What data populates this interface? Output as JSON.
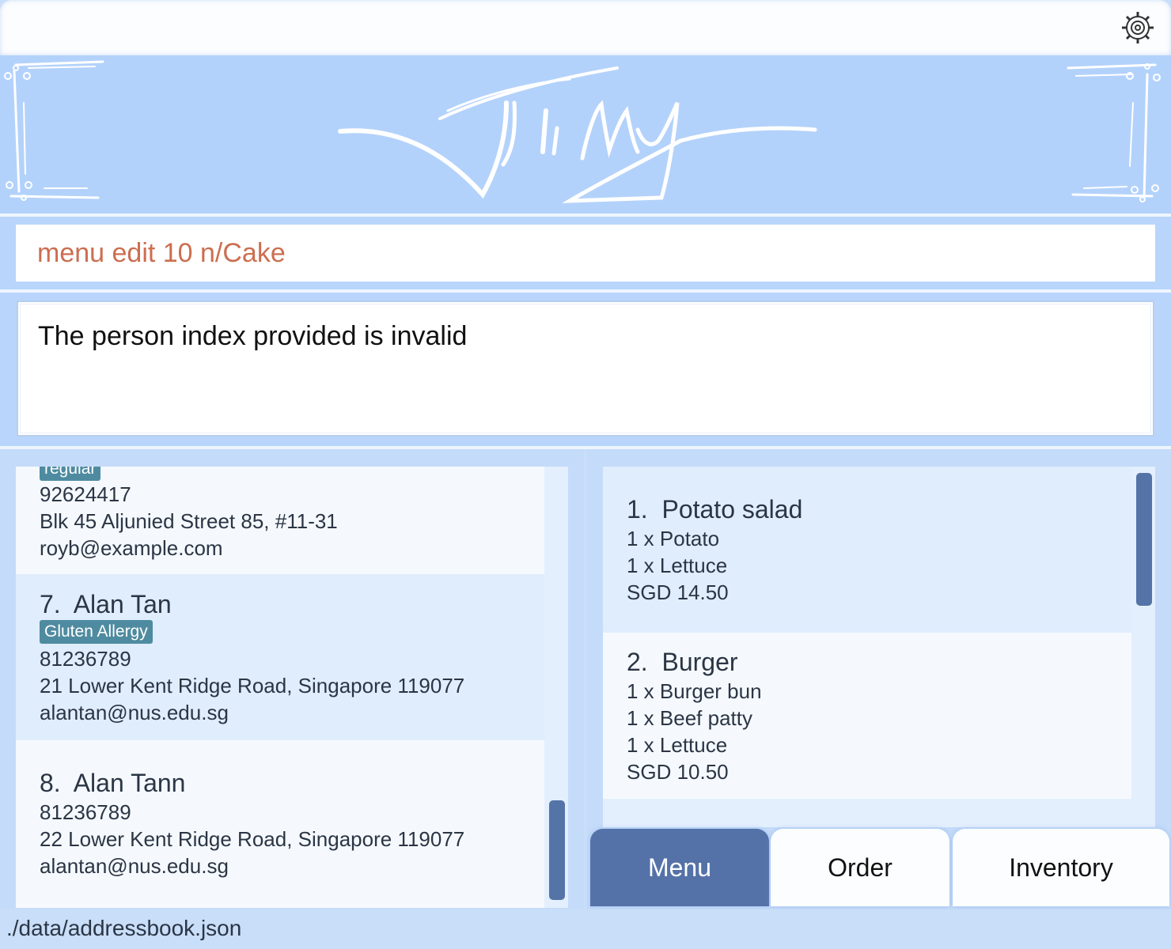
{
  "window": {
    "settings_icon": "gear-icon"
  },
  "banner": {
    "logo_text": "Jimy"
  },
  "command": {
    "value": "menu edit 10 n/Cake"
  },
  "result": {
    "message": "The person index provided is invalid"
  },
  "persons": [
    {
      "tag": "regular",
      "phone": "92624417",
      "address": "Blk 45 Aljunied Street 85, #11-31",
      "email": "royb@example.com"
    },
    {
      "index": "7.",
      "name": "Alan Tan",
      "tag": "Gluten Allergy",
      "phone": "81236789",
      "address": "21 Lower Kent Ridge Road, Singapore 119077",
      "email": "alantan@nus.edu.sg"
    },
    {
      "index": "8.",
      "name": "Alan Tann",
      "phone": "81236789",
      "address": "22 Lower Kent Ridge Road, Singapore 119077",
      "email": "alantan@nus.edu.sg"
    }
  ],
  "menu_items": [
    {
      "index": "1.",
      "name": "Potato salad",
      "ingredients": [
        "1 x Potato",
        "1 x Lettuce"
      ],
      "price": "SGD 14.50"
    },
    {
      "index": "2.",
      "name": "Burger",
      "ingredients": [
        "1 x Burger bun",
        "1 x Beef patty",
        "1 x Lettuce"
      ],
      "price": "SGD 10.50"
    }
  ],
  "tabs": [
    {
      "label": "Menu",
      "active": true
    },
    {
      "label": "Order",
      "active": false
    },
    {
      "label": "Inventory",
      "active": false
    }
  ],
  "status": {
    "file_path": "./data/addressbook.json"
  },
  "colors": {
    "background": "#c9def8",
    "banner": "#b3d2fb",
    "accent": "#5472a8",
    "tag": "#4f8ba0",
    "command_text": "#cc6e50"
  }
}
